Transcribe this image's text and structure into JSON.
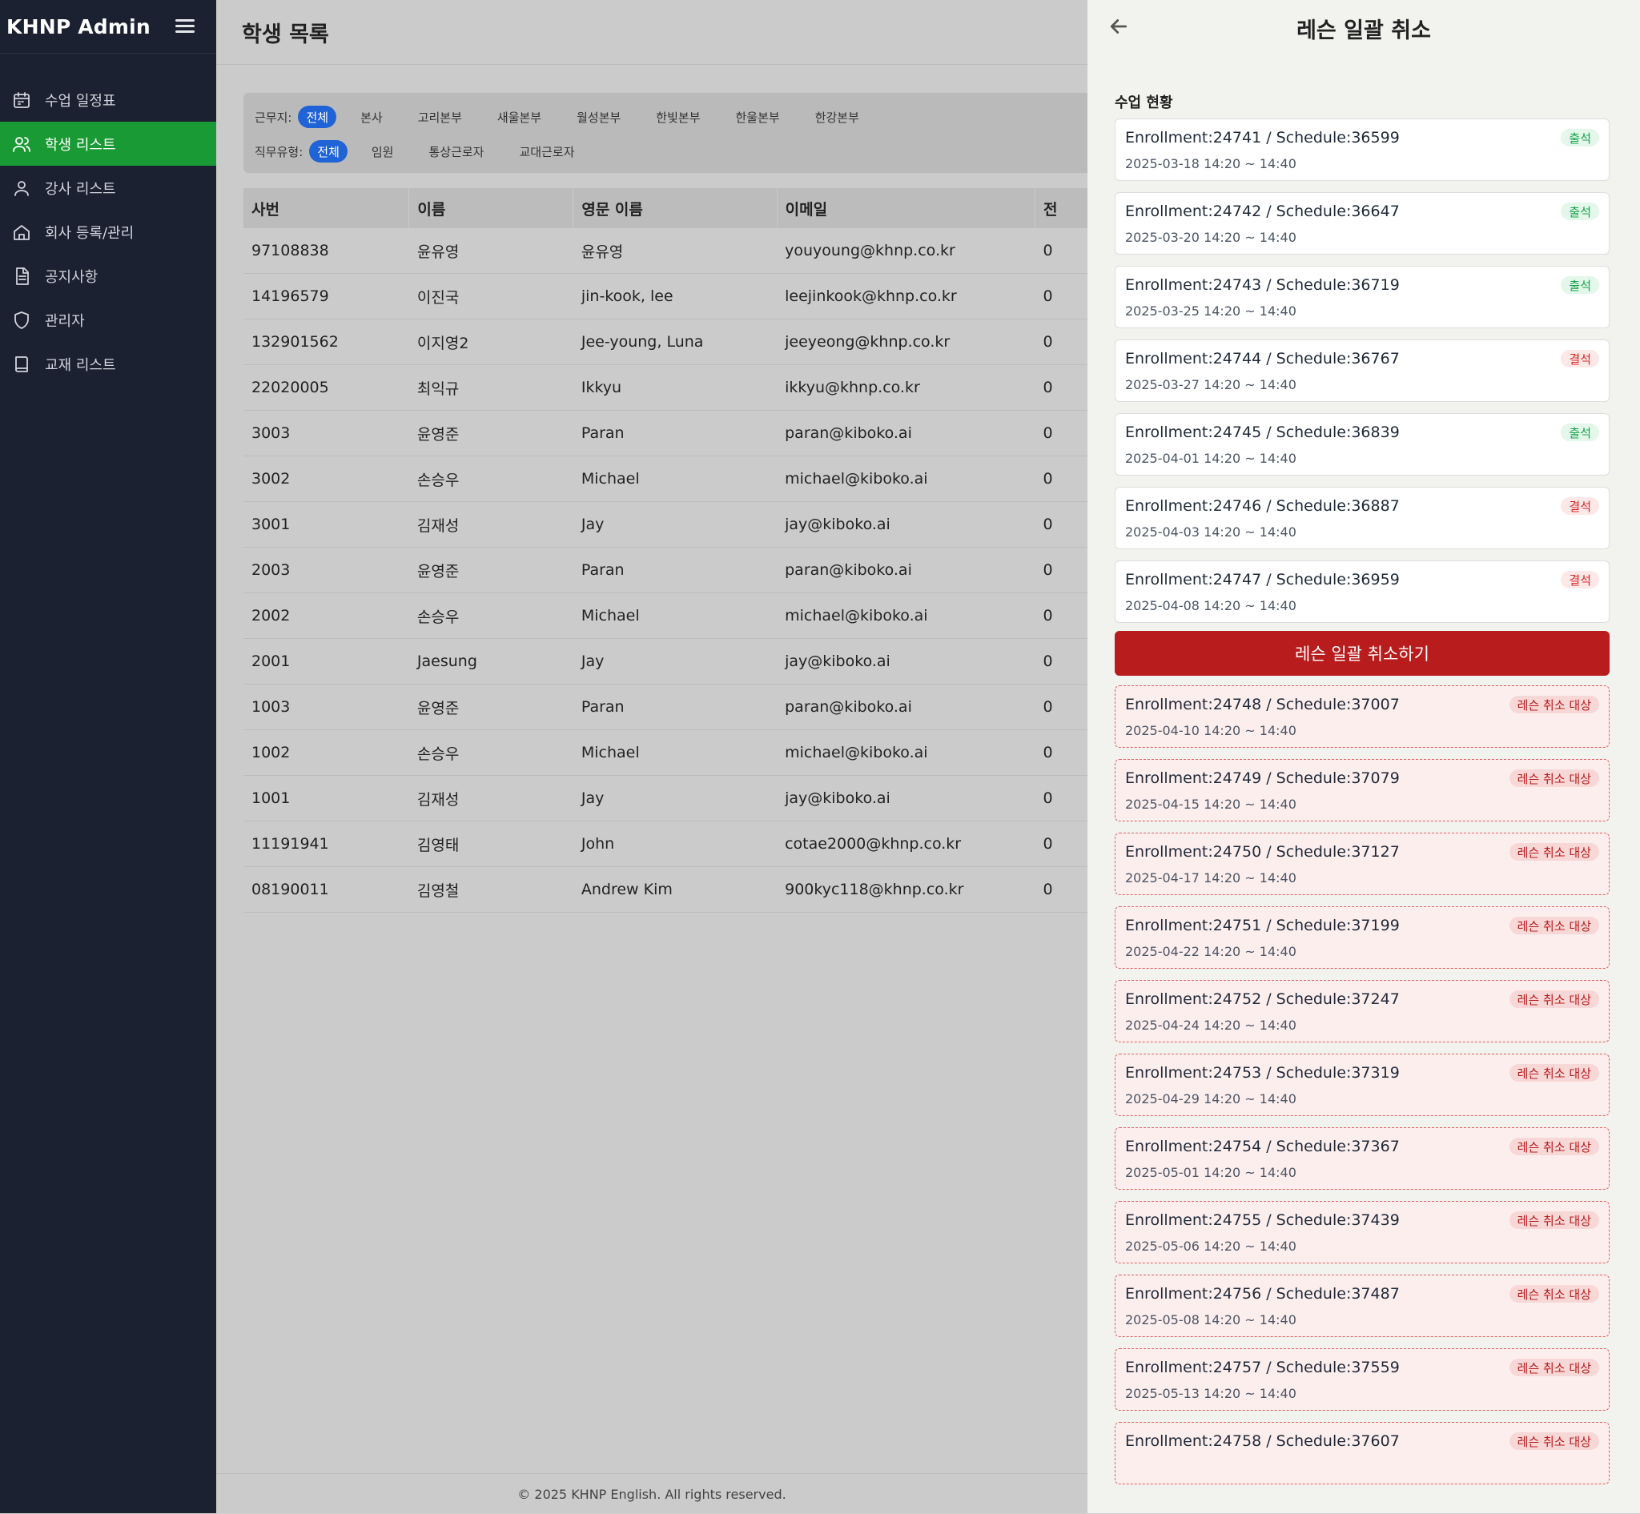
{
  "app": {
    "brand": "KHNP Admin"
  },
  "sidebar": {
    "items": [
      {
        "label": "수업 일정표",
        "icon": "calendar-icon"
      },
      {
        "label": "학생 리스트",
        "icon": "users-icon",
        "active": true
      },
      {
        "label": "강사 리스트",
        "icon": "user-icon"
      },
      {
        "label": "회사 등록/관리",
        "icon": "home-icon"
      },
      {
        "label": "공지사항",
        "icon": "document-icon"
      },
      {
        "label": "관리자",
        "icon": "shield-icon"
      },
      {
        "label": "교재 리스트",
        "icon": "book-icon"
      }
    ]
  },
  "main": {
    "title": "학생 목록",
    "filters": {
      "location_label": "근무지:",
      "locations": [
        "전체",
        "본사",
        "고리본부",
        "새울본부",
        "월성본부",
        "한빛본부",
        "한울본부",
        "한강본부"
      ],
      "jobtype_label": "직무유형:",
      "jobtypes": [
        "전체",
        "임원",
        "통상근로자",
        "교대근로자"
      ]
    },
    "table": {
      "headers": [
        "사번",
        "이름",
        "영문 이름",
        "이메일",
        "전"
      ],
      "rows": [
        [
          "97108838",
          "윤유영",
          "윤유영",
          "youyoung@khnp.co.kr",
          "0"
        ],
        [
          "14196579",
          "이진국",
          "jin-kook, lee",
          "leejinkook@khnp.co.kr",
          "0"
        ],
        [
          "132901562",
          "이지영2",
          "Jee-young, Luna",
          "jeeyeong@khnp.co.kr",
          "0"
        ],
        [
          "22020005",
          "최익규",
          "Ikkyu",
          "ikkyu@khnp.co.kr",
          "0"
        ],
        [
          "3003",
          "윤영준",
          "Paran",
          "paran@kiboko.ai",
          "0"
        ],
        [
          "3002",
          "손승우",
          "Michael",
          "michael@kiboko.ai",
          "0"
        ],
        [
          "3001",
          "김재성",
          "Jay",
          "jay@kiboko.ai",
          "0"
        ],
        [
          "2003",
          "윤영준",
          "Paran",
          "paran@kiboko.ai",
          "0"
        ],
        [
          "2002",
          "손승우",
          "Michael",
          "michael@kiboko.ai",
          "0"
        ],
        [
          "2001",
          "Jaesung",
          "Jay",
          "jay@kiboko.ai",
          "0"
        ],
        [
          "1003",
          "윤영준",
          "Paran",
          "paran@kiboko.ai",
          "0"
        ],
        [
          "1002",
          "손승우",
          "Michael",
          "michael@kiboko.ai",
          "0"
        ],
        [
          "1001",
          "김재성",
          "Jay",
          "jay@kiboko.ai",
          "0"
        ],
        [
          "11191941",
          "김영태",
          "John",
          "cotae2000@khnp.co.kr",
          "0"
        ],
        [
          "08190011",
          "김영철",
          "Andrew Kim",
          "900kyc118@khnp.co.kr",
          "0"
        ]
      ]
    },
    "footer": "© 2025 KHNP English. All rights reserved."
  },
  "panel": {
    "title": "레슨 일괄 취소",
    "section_label": "수업 현황",
    "cancel_button": "레슨 일괄 취소하기",
    "lessons": [
      {
        "title": "Enrollment:24741 / Schedule:36599",
        "date": "2025-03-18 14:20 ~ 14:40",
        "status": "출석",
        "kind": "attend"
      },
      {
        "title": "Enrollment:24742 / Schedule:36647",
        "date": "2025-03-20 14:20 ~ 14:40",
        "status": "출석",
        "kind": "attend"
      },
      {
        "title": "Enrollment:24743 / Schedule:36719",
        "date": "2025-03-25 14:20 ~ 14:40",
        "status": "출석",
        "kind": "attend"
      },
      {
        "title": "Enrollment:24744 / Schedule:36767",
        "date": "2025-03-27 14:20 ~ 14:40",
        "status": "결석",
        "kind": "absent"
      },
      {
        "title": "Enrollment:24745 / Schedule:36839",
        "date": "2025-04-01 14:20 ~ 14:40",
        "status": "출석",
        "kind": "attend"
      },
      {
        "title": "Enrollment:24746 / Schedule:36887",
        "date": "2025-04-03 14:20 ~ 14:40",
        "status": "결석",
        "kind": "absent"
      },
      {
        "title": "Enrollment:24747 / Schedule:36959",
        "date": "2025-04-08 14:20 ~ 14:40",
        "status": "결석",
        "kind": "absent"
      }
    ],
    "cancel_targets": [
      {
        "title": "Enrollment:24748 / Schedule:37007",
        "date": "2025-04-10 14:20 ~ 14:40",
        "status": "레슨 취소 대상"
      },
      {
        "title": "Enrollment:24749 / Schedule:37079",
        "date": "2025-04-15 14:20 ~ 14:40",
        "status": "레슨 취소 대상"
      },
      {
        "title": "Enrollment:24750 / Schedule:37127",
        "date": "2025-04-17 14:20 ~ 14:40",
        "status": "레슨 취소 대상"
      },
      {
        "title": "Enrollment:24751 / Schedule:37199",
        "date": "2025-04-22 14:20 ~ 14:40",
        "status": "레슨 취소 대상"
      },
      {
        "title": "Enrollment:24752 / Schedule:37247",
        "date": "2025-04-24 14:20 ~ 14:40",
        "status": "레슨 취소 대상"
      },
      {
        "title": "Enrollment:24753 / Schedule:37319",
        "date": "2025-04-29 14:20 ~ 14:40",
        "status": "레슨 취소 대상"
      },
      {
        "title": "Enrollment:24754 / Schedule:37367",
        "date": "2025-05-01 14:20 ~ 14:40",
        "status": "레슨 취소 대상"
      },
      {
        "title": "Enrollment:24755 / Schedule:37439",
        "date": "2025-05-06 14:20 ~ 14:40",
        "status": "레슨 취소 대상"
      },
      {
        "title": "Enrollment:24756 / Schedule:37487",
        "date": "2025-05-08 14:20 ~ 14:40",
        "status": "레슨 취소 대상"
      },
      {
        "title": "Enrollment:24757 / Schedule:37559",
        "date": "2025-05-13 14:20 ~ 14:40",
        "status": "레슨 취소 대상"
      },
      {
        "title": "Enrollment:24758 / Schedule:37607",
        "date": "",
        "status": "레슨 취소 대상"
      }
    ]
  }
}
